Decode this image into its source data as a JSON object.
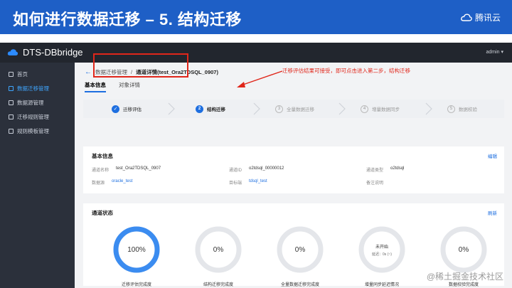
{
  "slide": {
    "title": "如何进行数据迁移 – 5. 结构迁移",
    "brand": "腾讯云"
  },
  "app": {
    "name": "DTS-DBbridge",
    "user": "admin ▾"
  },
  "sidebar": {
    "items": [
      {
        "label": "首页",
        "active": false
      },
      {
        "label": "数据迁移管理",
        "active": true
      },
      {
        "label": "数据源管理",
        "active": false
      },
      {
        "label": "迁移规则管理",
        "active": false
      },
      {
        "label": "规则模板管理",
        "active": false
      }
    ]
  },
  "breadcrumb": {
    "back": "←",
    "parent": "数据迁移管理",
    "sep": "/",
    "current": "通道详情(test_Ora2TDSQL_0907)"
  },
  "tabs": [
    {
      "label": "基本信息",
      "active": true
    },
    {
      "label": "对象详情",
      "active": false
    }
  ],
  "annotation": "迁移评估结果可接受，即可点击进入第二步，结构迁移",
  "steps": [
    {
      "num": "✓",
      "label": "迁移评估",
      "state": "done"
    },
    {
      "num": "2",
      "label": "结构迁移",
      "state": "current"
    },
    {
      "num": "3",
      "label": "全量数据迁移",
      "state": "todo"
    },
    {
      "num": "4",
      "label": "增量数据同步",
      "state": "todo"
    },
    {
      "num": "5",
      "label": "数据校验",
      "state": "todo"
    }
  ],
  "basic_info": {
    "title": "基本信息",
    "edit": "编辑",
    "fields": {
      "channel_name_label": "通道名称",
      "channel_name": "test_Ora2TDSQL_0907",
      "channel_id_label": "通道ID",
      "channel_id": "o2tdsql_00000012",
      "channel_type_label": "通道类型",
      "channel_type": "o2tdsql",
      "source_label": "数据源",
      "source": "oracle_test",
      "target_label": "目标端",
      "target": "tdsql_test",
      "remark_label": "备注说明",
      "remark": ""
    }
  },
  "channel_status": {
    "title": "通道状态",
    "refresh": "刷新",
    "gauges": [
      {
        "value": "100%",
        "label": "迁移评估完成度",
        "fraction": 1.0
      },
      {
        "value": "0%",
        "label": "结构迁移完成度",
        "fraction": 0
      },
      {
        "value": "0%",
        "label": "全量数据迁移完成度",
        "fraction": 0
      },
      {
        "value": "未开始",
        "sub": "延迟：0s (~)",
        "label": "增量同步延迟情况",
        "fraction": 0
      },
      {
        "value": "0%",
        "label": "数据校验完成度",
        "fraction": 0
      }
    ]
  },
  "watermark": "@稀土掘金技术社区",
  "colors": {
    "header": "#1e5fc6",
    "accent": "#1e6fe0",
    "annotation": "#e0261a",
    "topbar": "#22262e",
    "sidebar": "#2b303b"
  }
}
